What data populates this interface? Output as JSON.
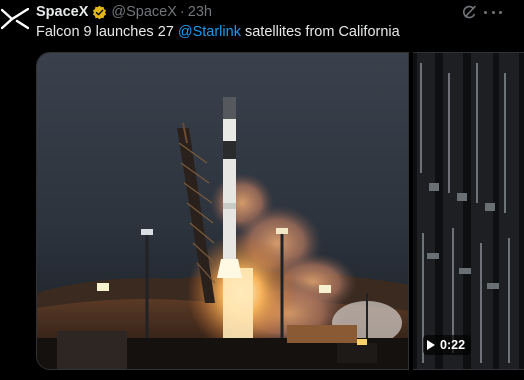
{
  "author": {
    "name": "SpaceX",
    "handle": "@SpaceX",
    "separator": "·",
    "time": "23h",
    "avatar_icon": "spacex-x-logo-icon",
    "verified_icon": "verified-badge-icon",
    "verified_color": "#e2b719"
  },
  "post": {
    "text_before": "Falcon 9 launches 27 ",
    "mention": "@Starlink",
    "text_after": " satellites from California",
    "mention_color": "#1d9bf0"
  },
  "actions": {
    "grok_icon": "grok-icon",
    "more_icon": "more-options-icon"
  },
  "media": {
    "main_image": "falcon-9-launch-photo",
    "side_video": "rocket-closeup-video",
    "video_duration": "0:22",
    "play_icon": "play-icon"
  }
}
